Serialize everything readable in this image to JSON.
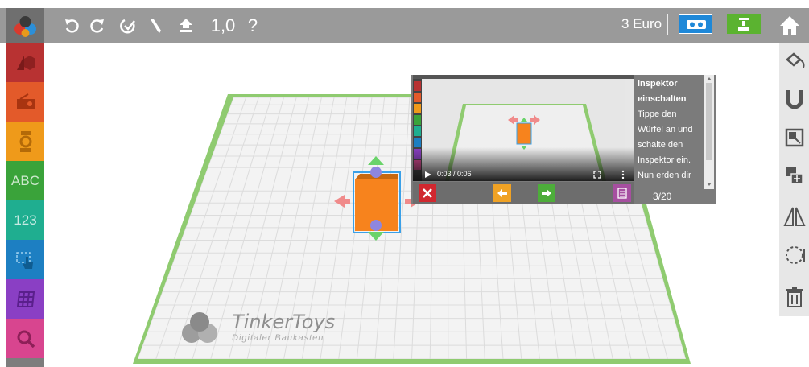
{
  "toolbar": {
    "undo_icon": "undo-icon",
    "redo_icon": "redo-icon",
    "zoom_value": "1,0",
    "help_label": "?",
    "price": "3 Euro",
    "colors": {
      "bar": "#9a9a9a",
      "vr": "#1e88d8",
      "print": "#5bb330"
    }
  },
  "palette": {
    "items": [
      {
        "name": "shapes",
        "color": "#b83232"
      },
      {
        "name": "objects",
        "color": "#e35a2a"
      },
      {
        "name": "figures",
        "color": "#ef9a1a"
      },
      {
        "name": "letters",
        "label": "ABC",
        "color": "#3aa33a"
      },
      {
        "name": "numbers",
        "label": "123",
        "color": "#1fae90"
      },
      {
        "name": "selection",
        "color": "#1d7fc2"
      },
      {
        "name": "grid",
        "color": "#8a3fc4"
      },
      {
        "name": "search",
        "color": "#d8458f"
      }
    ]
  },
  "tools": {
    "items": [
      "paint-icon",
      "magnet-icon",
      "resize-icon",
      "duplicate-icon",
      "mirror-icon",
      "rotate-icon",
      "trash-icon"
    ]
  },
  "workspace": {
    "brand": "TinkerToys",
    "tagline": "Digitaler Baukasten"
  },
  "tutorial": {
    "title_line1": "Inspektor",
    "title_line2": "einschalten",
    "body_lines": [
      "Tippe den",
      "Würfel an und",
      "schalte den",
      "Inspektor ein.",
      "Nun erden dir"
    ],
    "video_time": "0:03 / 0:06",
    "step": "3/20",
    "buttons": {
      "close": "#d0282f",
      "back": "#f0a224",
      "next": "#4dad3a",
      "notes": "#a64fa0"
    }
  }
}
